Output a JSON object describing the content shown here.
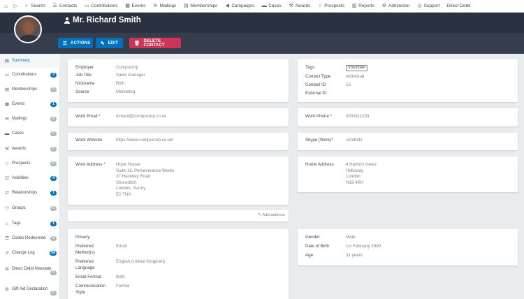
{
  "topnav": {
    "items": [
      {
        "icon": "search-icon",
        "label": "Search"
      },
      {
        "icon": "contacts-icon",
        "label": "Contacts"
      },
      {
        "icon": "credit-card-icon",
        "label": "Contributions"
      },
      {
        "icon": "calendar-icon",
        "label": "Events"
      },
      {
        "icon": "envelope-icon",
        "label": "Mailings"
      },
      {
        "icon": "id-card-icon",
        "label": "Memberships"
      },
      {
        "icon": "bullhorn-icon",
        "label": "Campaigns"
      },
      {
        "icon": "folder-icon",
        "label": "Cases"
      },
      {
        "icon": "gavel-icon",
        "label": "Awards"
      },
      {
        "icon": "star-icon",
        "label": "Prospects"
      },
      {
        "icon": "bar-chart-icon",
        "label": "Reports"
      },
      {
        "icon": "gears-icon",
        "label": "Administer"
      },
      {
        "icon": "life-ring-icon",
        "label": "Support"
      },
      {
        "icon": "",
        "label": "Direct Debit"
      }
    ]
  },
  "contact": {
    "name": "Mr. Richard Smith"
  },
  "actions": {
    "actions_label": "ACTIONS",
    "edit_label": "EDIT",
    "delete_label": "DELETE CONTACT"
  },
  "sidebar": {
    "items": [
      {
        "label": "Summary",
        "icon": "id-card-icon",
        "count": ""
      },
      {
        "label": "Contributions",
        "icon": "credit-card-icon",
        "count": "3"
      },
      {
        "label": "Memberships",
        "icon": "id-badge-icon",
        "count": "0"
      },
      {
        "label": "Events",
        "icon": "calendar-icon",
        "count": "1"
      },
      {
        "label": "Mailings",
        "icon": "envelope-icon",
        "count": "0"
      },
      {
        "label": "Cases",
        "icon": "folder-icon",
        "count": "0"
      },
      {
        "label": "Awards",
        "icon": "gavel-icon",
        "count": "0"
      },
      {
        "label": "Prospects",
        "icon": "star-icon",
        "count": "0"
      },
      {
        "label": "Activities",
        "icon": "tasks-icon",
        "count": "4"
      },
      {
        "label": "Relationships",
        "icon": "handshake-icon",
        "count": "1"
      },
      {
        "label": "Groups",
        "icon": "users-icon",
        "count": "0"
      },
      {
        "label": "Tags",
        "icon": "tags-icon",
        "count": "1"
      },
      {
        "label": "Codes Redeemed",
        "icon": "list-icon",
        "count": "0"
      },
      {
        "label": "Change Log",
        "icon": "history-icon",
        "count": "54"
      },
      {
        "label": "Direct Debit Mandate",
        "icon": "gear-icon",
        "count": "0"
      },
      {
        "label": "Gift Aid Declaration",
        "icon": "gear-icon",
        "count": "0"
      }
    ]
  },
  "employment": {
    "employer_label": "Employer",
    "employer": "Compucorp",
    "job_title_label": "Job Title",
    "job_title": "Sales manager",
    "nickname_label": "Nickname",
    "nickname": "Rich",
    "source_label": "Source",
    "source": "Marketing"
  },
  "tags_card": {
    "tags_label": "Tags",
    "tag": "Volunteer",
    "contact_type_label": "Contact Type",
    "contact_type": "Individual",
    "contact_id_label": "Contact ID",
    "contact_id": "15",
    "external_id_label": "External ID",
    "external_id": ""
  },
  "email": {
    "label": "Work Email *",
    "value": "richard@compucorp.co.uk"
  },
  "phone": {
    "label": "Work Phone *",
    "value": "0203111233"
  },
  "website": {
    "label": "Work Website",
    "value": "https://www.compucorp.co.uk/"
  },
  "skype": {
    "label": "Skype (Work)*",
    "value": "rsmith91"
  },
  "work_address": {
    "label": "Work Address *",
    "value": "Hope House\nSuite 16, Perseverance Works\n37 Hackney Road\nShoreditch\nLondon, Surrey\nE2 7NX"
  },
  "home_address": {
    "label": "Home Address",
    "value": "4 Harford mews\nHolloway\nLondon\nN19 4RH"
  },
  "add_address_label": "Add address",
  "preferences": {
    "privacy_label": "Privacy",
    "preferred_method_label": "Preferred Method(s)",
    "preferred_method": "Email",
    "preferred_language_label": "Preferred Language",
    "preferred_language": "English (United Kingdom)",
    "email_format_label": "Email Format",
    "email_format": "Both",
    "communication_style_label": "Communication Style",
    "communication_style": "Formal"
  },
  "demographics": {
    "gender_label": "Gender",
    "gender": "Male",
    "dob_label": "Date of Birth",
    "dob": "1st February 1990",
    "age_label": "Age",
    "age": "31 years"
  },
  "colors": {
    "primary": "#0071bd",
    "danger": "#cf3458",
    "header": "#2a3140",
    "badge_grey": "#aeb4ba"
  }
}
